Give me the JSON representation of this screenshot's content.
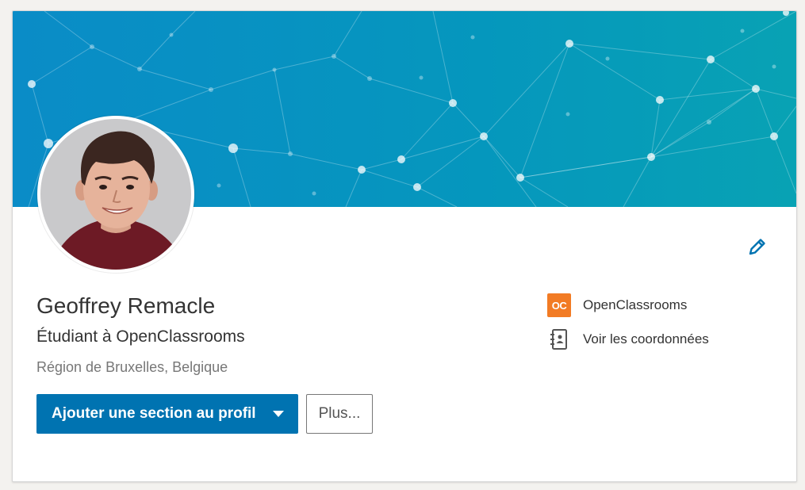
{
  "profile": {
    "name": "Geoffrey Remacle",
    "headline": "Étudiant à OpenClassrooms",
    "location": "Région de Bruxelles, Belgique"
  },
  "actions": {
    "add_section_label": "Ajouter une section au profil",
    "more_label": "Plus..."
  },
  "sidebar": {
    "company": {
      "logo_text": "OC",
      "label": "OpenClassrooms"
    },
    "contact": {
      "label": "Voir les coordonnées"
    }
  },
  "icons": {
    "edit": "pencil-icon",
    "add_section_caret": "caret-down-icon",
    "contact": "address-book-icon",
    "company": "openclassrooms-logo"
  },
  "colors": {
    "primary": "#0073b1",
    "banner_start": "#0a8fc4",
    "banner_end": "#0aa0b8",
    "company_logo": "#f27b24"
  }
}
